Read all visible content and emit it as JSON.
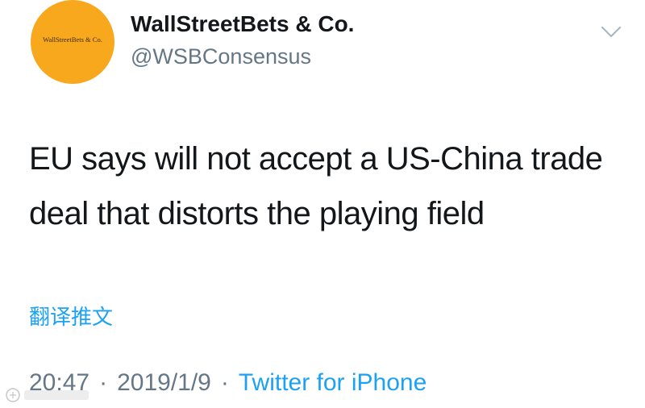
{
  "user": {
    "avatar_text": "WallStreetBets & Co.",
    "display_name": "WallStreetBets & Co.",
    "handle": "@WSBConsensus"
  },
  "menu": {
    "icon": "chevron-down-icon"
  },
  "tweet": {
    "text": "EU says will not accept a US-China trade deal that distorts the playing field",
    "translate_label": "翻译推文"
  },
  "meta": {
    "time": "20:47",
    "separator": "·",
    "date": "2019/1/9",
    "source": "Twitter for iPhone"
  },
  "colors": {
    "avatar_bg": "#f8a81c",
    "link": "#1da1f2",
    "secondary_text": "#657786",
    "primary_text": "#14171a"
  }
}
